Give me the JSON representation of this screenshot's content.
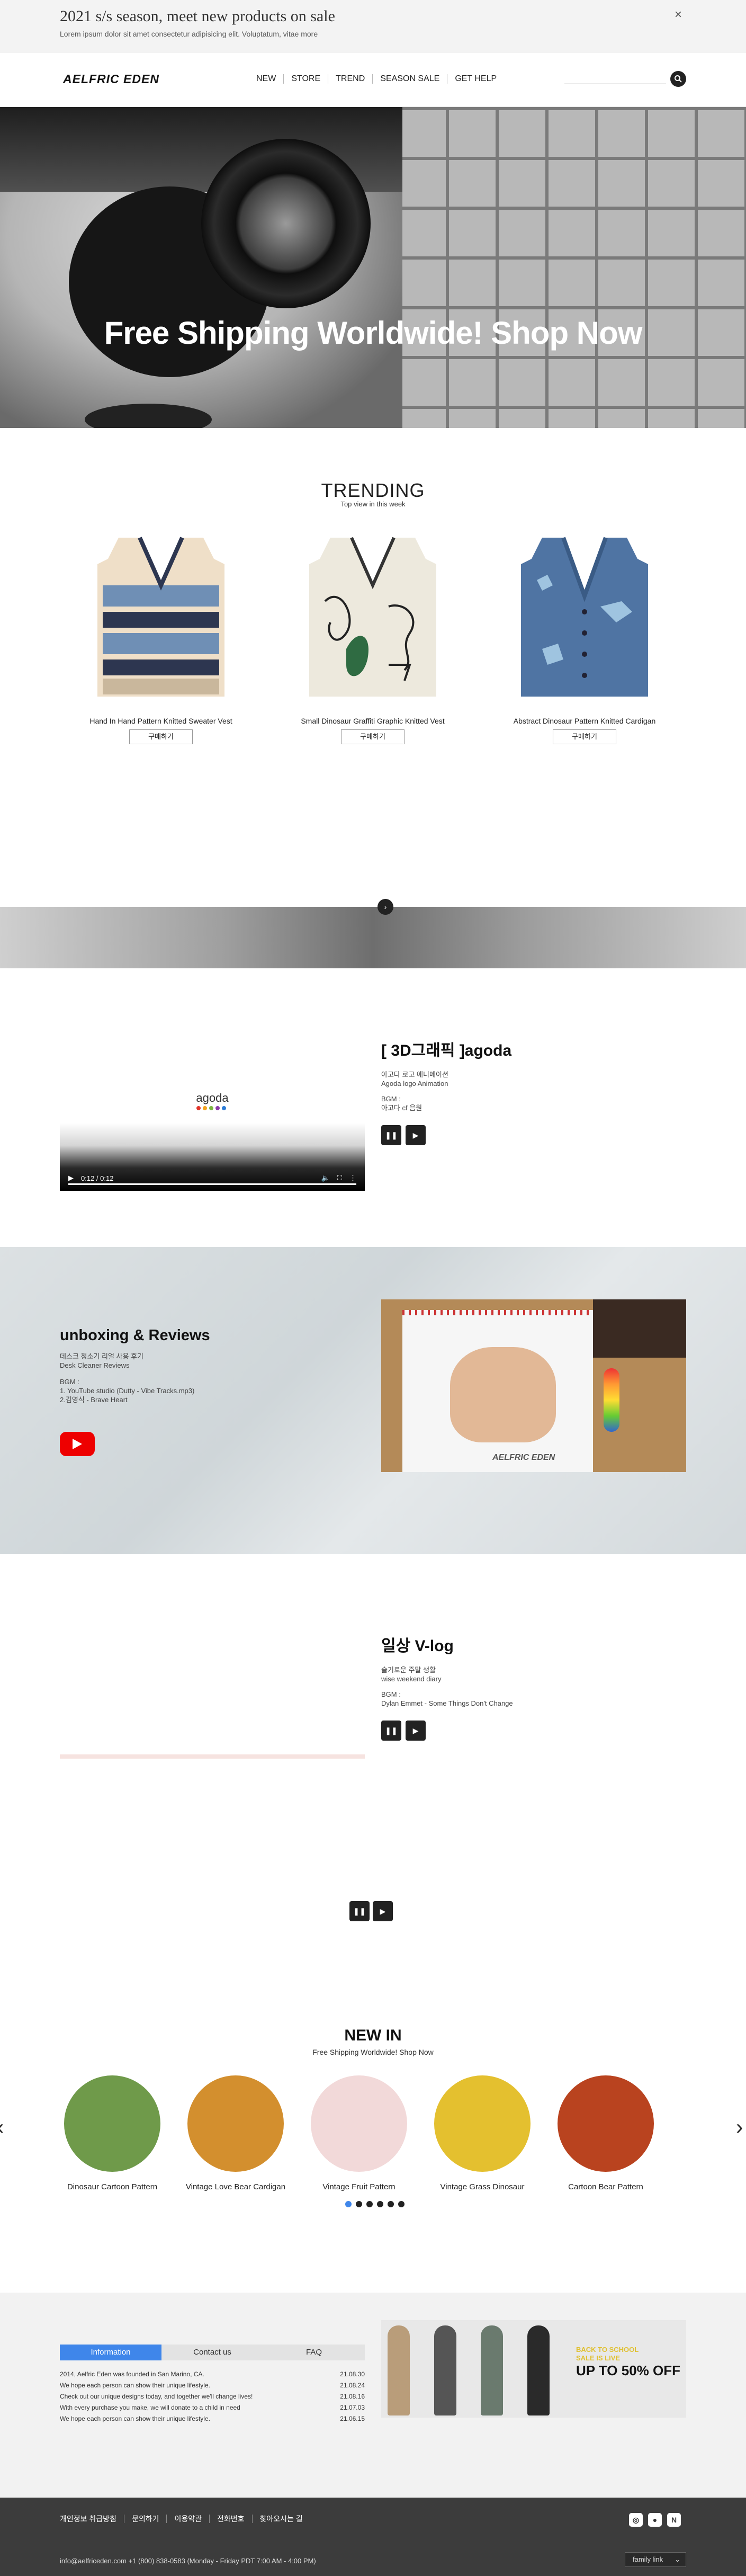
{
  "top_banner": {
    "title": "2021 s/s season, meet new products on sale",
    "subtitle": "Lorem ipsum dolor sit amet consectetur adipisicing elit. Voluptatum, vitae more",
    "close": "×"
  },
  "header": {
    "logo": "AELFRIC EDEN",
    "nav": [
      "NEW",
      "STORE",
      "TREND",
      "SEASON SALE",
      "GET HELP"
    ],
    "search_icon": "search-icon"
  },
  "hero": {
    "headline": "Free Shipping Worldwide! Shop Now"
  },
  "trending": {
    "title": "TRENDING",
    "subtitle": "Top view in this week",
    "buy_label": "구매하기",
    "products": [
      {
        "name": "Hand In Hand Pattern Knitted Sweater Vest"
      },
      {
        "name": "Small Dinosaur Graffiti Graphic Knitted Vest"
      },
      {
        "name": "Abstract Dinosaur Pattern Knitted Cardigan"
      }
    ]
  },
  "video1": {
    "brand": "agoda",
    "time": "0:12 / 0:12",
    "title": "[ 3D그래픽 ]agoda",
    "lines": [
      "아고다 로고 애니메이션",
      "Agoda logo Animation"
    ],
    "bgm_label": "BGM :",
    "bgm": "아고다 cf 음원"
  },
  "unboxing": {
    "title": "unboxing & Reviews",
    "lines": [
      "데스크 청소기 리얼 사용 후기",
      "Desk Cleaner Reviews"
    ],
    "bgm_label": "BGM :",
    "bgm_lines": [
      "1. YouTube studio (Dutty - Vibe Tracks.mp3)",
      "2.김영식 - Brave Heart"
    ],
    "photo_text": "AELFRIC EDEN"
  },
  "vlog": {
    "title": "일상 V-log",
    "lines": [
      "슬기로운 주말 생활",
      "wise weekend diary"
    ],
    "bgm_label": "BGM :",
    "bgm": "Dylan Emmet - Some Things Don't Change"
  },
  "new_in": {
    "title": "NEW IN",
    "subtitle": "Free Shipping Worldwide! Shop Now",
    "prev": "‹",
    "next": "›",
    "items": [
      {
        "name": "Dinosaur Cartoon Pattern",
        "color": "#6f9a4a"
      },
      {
        "name": "Vintage Love Bear Cardigan",
        "color": "#d38f2e"
      },
      {
        "name": "Vintage Fruit Pattern",
        "color": "#f2d9d9"
      },
      {
        "name": "Vintage Grass Dinosaur",
        "color": "#e4c02f"
      },
      {
        "name": "Cartoon Bear Pattern",
        "color": "#b9431f"
      }
    ]
  },
  "footer": {
    "tabs": [
      "Information",
      "Contact us",
      "FAQ"
    ],
    "news": [
      {
        "text": "2014, Aelfric Eden was founded in San Marino, CA.",
        "date": "21.08.30"
      },
      {
        "text": "We hope each person can show their unique lifestyle.",
        "date": "21.08.24"
      },
      {
        "text": "Check out our unique designs today, and together we'll change lives!",
        "date": "21.08.16"
      },
      {
        "text": "With every purchase you make, we will donate to a child in need",
        "date": "21.07.03"
      },
      {
        "text": "We hope each person can show their unique lifestyle.",
        "date": "21.06.15"
      }
    ],
    "banner_small": "BACK TO SCHOOL",
    "banner_small2": "SALE IS LIVE",
    "banner_big": "UP TO 50% OFF",
    "links": [
      "개인정보 취급방침",
      "문의하기",
      "이용약관",
      "전화번호",
      "찾아오시는 길"
    ],
    "contact": "info@aelfriceden.com +1 (800) 838-0583   (Monday - Friday PDT 7:00 AM - 4:00 PM)",
    "family": "family link",
    "social": [
      "instagram-icon",
      "talk-icon",
      "blog-icon"
    ]
  }
}
